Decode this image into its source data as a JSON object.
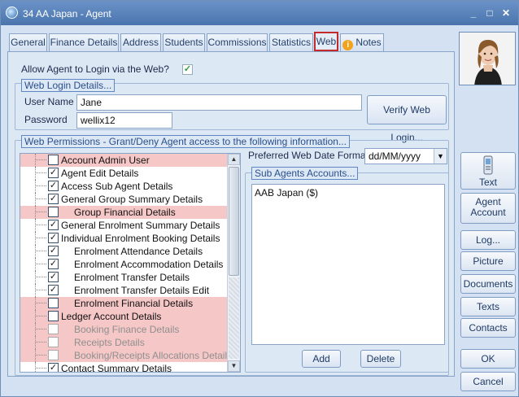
{
  "window": {
    "title": "34 AA Japan - Agent",
    "controls": {
      "minimize": "_",
      "maximize": "□",
      "close": "✕"
    }
  },
  "tabs": [
    {
      "label": "General"
    },
    {
      "label": "Finance Details"
    },
    {
      "label": "Address"
    },
    {
      "label": "Students"
    },
    {
      "label": "Commissions"
    },
    {
      "label": "Statistics"
    },
    {
      "label": "Web",
      "active": true
    },
    {
      "label": "Notes",
      "icon": "info-icon",
      "icon_glyph": "i"
    }
  ],
  "web": {
    "allow_login_label": "Allow Agent to Login via the Web?",
    "allow_login_checked": true,
    "login_group_title": "Web Login Details...",
    "username_label": "User Name",
    "username_value": "Jane",
    "password_label": "Password",
    "password_value": "wellix12",
    "verify_button": "Verify Web Login...",
    "permissions_group_title": "Web Permissions - Grant/Deny Agent access to the following information...",
    "permissions": [
      {
        "label": "Account Admin User",
        "checked": false,
        "pink": true,
        "level": 0,
        "dim": false
      },
      {
        "label": "Agent Edit Details",
        "checked": true,
        "pink": false,
        "level": 0,
        "dim": false
      },
      {
        "label": "Access Sub Agent Details",
        "checked": true,
        "pink": false,
        "level": 0,
        "dim": false
      },
      {
        "label": "General Group Summary Details",
        "checked": true,
        "pink": false,
        "level": 0,
        "dim": false
      },
      {
        "label": "Group Financial Details",
        "checked": false,
        "pink": true,
        "level": 1,
        "dim": false
      },
      {
        "label": "General Enrolment Summary Details",
        "checked": true,
        "pink": false,
        "level": 0,
        "dim": false
      },
      {
        "label": "Individual Enrolment Booking Details",
        "checked": true,
        "pink": false,
        "level": 0,
        "dim": false
      },
      {
        "label": "Enrolment Attendance Details",
        "checked": true,
        "pink": false,
        "level": 1,
        "dim": false
      },
      {
        "label": "Enrolment Accommodation Details",
        "checked": true,
        "pink": false,
        "level": 1,
        "dim": false
      },
      {
        "label": "Enrolment Transfer Details",
        "checked": true,
        "pink": false,
        "level": 1,
        "dim": false
      },
      {
        "label": "Enrolment Transfer Details Edit",
        "checked": true,
        "pink": false,
        "level": 1,
        "dim": false
      },
      {
        "label": "Enrolment Financial Details",
        "checked": false,
        "pink": true,
        "level": 1,
        "dim": false
      },
      {
        "label": "Ledger Account Details",
        "checked": false,
        "pink": true,
        "level": 0,
        "dim": false
      },
      {
        "label": "Booking Finance Details",
        "checked": false,
        "pink": true,
        "level": 1,
        "dim": true
      },
      {
        "label": "Receipts Details",
        "checked": false,
        "pink": true,
        "level": 1,
        "dim": true
      },
      {
        "label": "Booking/Receipts Allocations Details",
        "checked": false,
        "pink": true,
        "level": 1,
        "dim": true
      },
      {
        "label": "Contact Summary Details",
        "checked": true,
        "pink": false,
        "level": 0,
        "dim": false
      }
    ],
    "date_format_label": "Preferred Web Date Format",
    "date_format_value": "dd/MM/yyyy",
    "sub_agents_group_title": "Sub Agents Accounts...",
    "sub_agents": [
      "AAB Japan ($)"
    ],
    "add_button": "Add",
    "delete_button": "Delete"
  },
  "side_buttons": {
    "text": "Text",
    "agent_account": "Agent Account",
    "log": "Log...",
    "picture": "Picture",
    "documents": "Documents",
    "texts": "Texts",
    "contacts": "Contacts",
    "ok": "OK",
    "cancel": "Cancel"
  },
  "colors": {
    "title_bar": "#5580bd",
    "active_tab_border": "#c32a2a",
    "denied_row": "#f6c7c7",
    "group_title_border": "#5f87c4"
  }
}
